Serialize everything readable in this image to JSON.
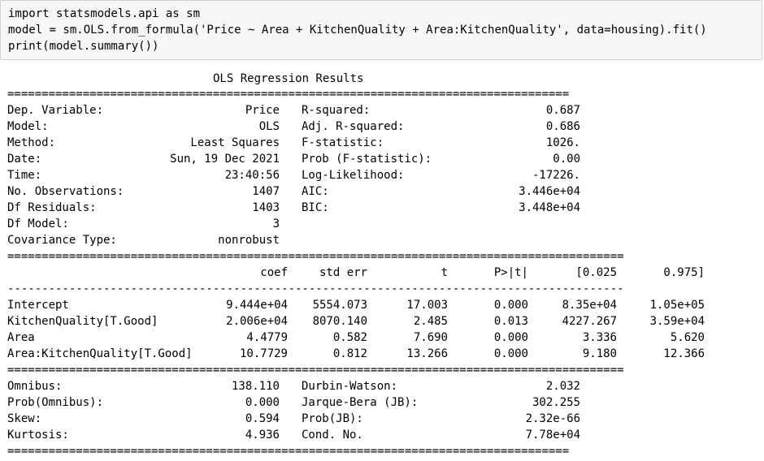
{
  "code": {
    "line1": "import statsmodels.api as sm",
    "line2": "model = sm.OLS.from_formula('Price ~ Area + KitchenQuality + Area:KitchenQuality', data=housing).fit()",
    "line3": "print(model.summary())"
  },
  "summary": {
    "title": "OLS Regression Results",
    "rules": {
      "double_wide": "==================================================================================",
      "double_full": "==========================================================================================",
      "single_full": "------------------------------------------------------------------------------------------"
    },
    "header_rows": [
      {
        "l_label": "Dep. Variable:",
        "l_value": "Price",
        "r_label": "R-squared:",
        "r_value": "0.687"
      },
      {
        "l_label": "Model:",
        "l_value": "OLS",
        "r_label": "Adj. R-squared:",
        "r_value": "0.686"
      },
      {
        "l_label": "Method:",
        "l_value": "Least Squares",
        "r_label": "F-statistic:",
        "r_value": "1026."
      },
      {
        "l_label": "Date:",
        "l_value": "Sun, 19 Dec 2021",
        "r_label": "Prob (F-statistic):",
        "r_value": "0.00"
      },
      {
        "l_label": "Time:",
        "l_value": "23:40:56",
        "r_label": "Log-Likelihood:",
        "r_value": "-17226."
      },
      {
        "l_label": "No. Observations:",
        "l_value": "1407",
        "r_label": "AIC:",
        "r_value": "3.446e+04"
      },
      {
        "l_label": "Df Residuals:",
        "l_value": "1403",
        "r_label": "BIC:",
        "r_value": "3.448e+04"
      },
      {
        "l_label": "Df Model:",
        "l_value": "3",
        "r_label": "",
        "r_value": ""
      },
      {
        "l_label": "Covariance Type:",
        "l_value": "nonrobust",
        "r_label": "",
        "r_value": ""
      }
    ],
    "coef_columns": [
      "coef",
      "std err",
      "t",
      "P>|t|",
      "[0.025",
      "0.975]"
    ],
    "coef_rows": [
      {
        "name": "Intercept",
        "values": [
          "9.444e+04",
          "5554.073",
          "17.003",
          "0.000",
          "8.35e+04",
          "1.05e+05"
        ]
      },
      {
        "name": "KitchenQuality[T.Good]",
        "values": [
          "2.006e+04",
          "8070.140",
          "2.485",
          "0.013",
          "4227.267",
          "3.59e+04"
        ]
      },
      {
        "name": "Area",
        "values": [
          "4.4779",
          "0.582",
          "7.690",
          "0.000",
          "3.336",
          "5.620"
        ]
      },
      {
        "name": "Area:KitchenQuality[T.Good]",
        "values": [
          "10.7729",
          "0.812",
          "13.266",
          "0.000",
          "9.180",
          "12.366"
        ]
      }
    ],
    "diag_rows": [
      {
        "l_label": "Omnibus:",
        "l_value": "138.110",
        "r_label": "Durbin-Watson:",
        "r_value": "2.032"
      },
      {
        "l_label": "Prob(Omnibus):",
        "l_value": "0.000",
        "r_label": "Jarque-Bera (JB):",
        "r_value": "302.255"
      },
      {
        "l_label": "Skew:",
        "l_value": "0.594",
        "r_label": "Prob(JB):",
        "r_value": "2.32e-66"
      },
      {
        "l_label": "Kurtosis:",
        "l_value": "4.936",
        "r_label": "Cond. No.",
        "r_value": "7.78e+04"
      }
    ]
  }
}
